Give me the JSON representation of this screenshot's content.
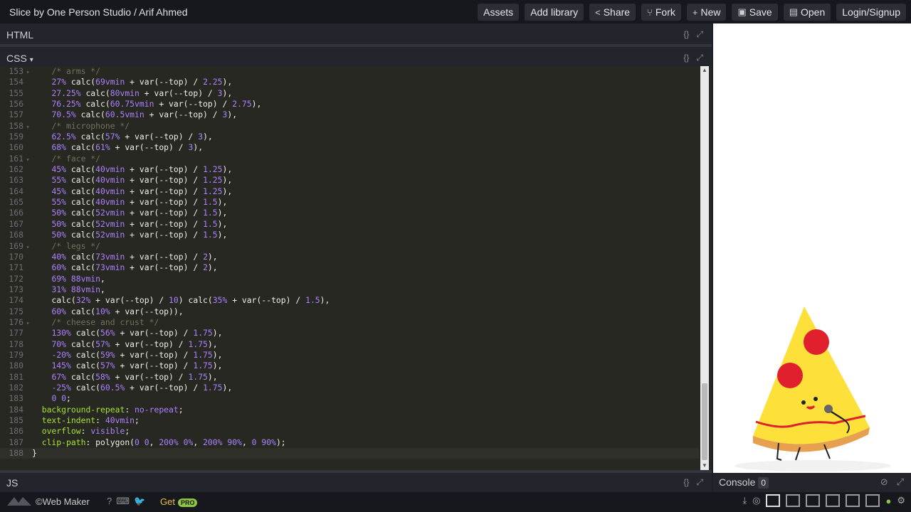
{
  "topbar": {
    "title": "Slice by One Person Studio / Arif Ahmed",
    "buttons": [
      "Assets",
      "Add library",
      "Share",
      "Fork",
      "New",
      "Save",
      "Open",
      "Login/Signup"
    ]
  },
  "panes": {
    "html": "HTML",
    "css": "CSS",
    "js": "JS",
    "console": "Console",
    "console_count": "0",
    "ctrl_format": "{}",
    "ctrl_expand": "⤢"
  },
  "code_lines": [
    {
      "n": "153",
      "fold": true,
      "html": "    <span class='cmt'>/* arms */</span>"
    },
    {
      "n": "154",
      "fold": false,
      "html": "    <span class='num'>27%</span> calc(<span class='num'>69vmin</span> + var(<span class='code'>--top</span>) / <span class='num'>2.25</span>),"
    },
    {
      "n": "155",
      "fold": false,
      "html": "    <span class='num'>27.25%</span> calc(<span class='num'>80vmin</span> + var(--top) / <span class='num'>3</span>),"
    },
    {
      "n": "156",
      "fold": false,
      "html": "    <span class='num'>76.25%</span> calc(<span class='num'>60.75vmin</span> + var(--top) / <span class='num'>2.75</span>),"
    },
    {
      "n": "157",
      "fold": false,
      "html": "    <span class='num'>70.5%</span> calc(<span class='num'>60.5vmin</span> + var(--top) / <span class='num'>3</span>),"
    },
    {
      "n": "158",
      "fold": true,
      "html": "    <span class='cmt'>/* microphone */</span>"
    },
    {
      "n": "159",
      "fold": false,
      "html": "    <span class='num'>62.5%</span> calc(<span class='num'>57%</span> + var(--top) / <span class='num'>3</span>),"
    },
    {
      "n": "160",
      "fold": false,
      "html": "    <span class='num'>68%</span> calc(<span class='num'>61%</span> + var(--top) / <span class='num'>3</span>),"
    },
    {
      "n": "161",
      "fold": true,
      "html": "    <span class='cmt'>/* face */</span>"
    },
    {
      "n": "162",
      "fold": false,
      "html": "    <span class='num'>45%</span> calc(<span class='num'>40vmin</span> + var(--top) / <span class='num'>1.25</span>),"
    },
    {
      "n": "163",
      "fold": false,
      "html": "    <span class='num'>55%</span> calc(<span class='num'>40vmin</span> + var(--top) / <span class='num'>1.25</span>),"
    },
    {
      "n": "164",
      "fold": false,
      "html": "    <span class='num'>45%</span> calc(<span class='num'>40vmin</span> + var(--top) / <span class='num'>1.25</span>),"
    },
    {
      "n": "165",
      "fold": false,
      "html": "    <span class='num'>55%</span> calc(<span class='num'>40vmin</span> + var(--top) / <span class='num'>1.5</span>),"
    },
    {
      "n": "166",
      "fold": false,
      "html": "    <span class='num'>50%</span> calc(<span class='num'>52vmin</span> + var(--top) / <span class='num'>1.5</span>),"
    },
    {
      "n": "167",
      "fold": false,
      "html": "    <span class='num'>50%</span> calc(<span class='num'>52vmin</span> + var(--top) / <span class='num'>1.5</span>),"
    },
    {
      "n": "168",
      "fold": false,
      "html": "    <span class='num'>50%</span> calc(<span class='num'>52vmin</span> + var(--top) / <span class='num'>1.5</span>),"
    },
    {
      "n": "169",
      "fold": true,
      "html": "    <span class='cmt'>/* legs */</span>"
    },
    {
      "n": "170",
      "fold": false,
      "html": "    <span class='num'>40%</span> calc(<span class='num'>73vmin</span> + var(--top) / <span class='num'>2</span>),"
    },
    {
      "n": "171",
      "fold": false,
      "html": "    <span class='num'>60%</span> calc(<span class='num'>73vmin</span> + var(--top) / <span class='num'>2</span>),"
    },
    {
      "n": "172",
      "fold": false,
      "html": "    <span class='num'>69%</span> <span class='num'>88vmin</span>,"
    },
    {
      "n": "173",
      "fold": false,
      "html": "    <span class='num'>31%</span> <span class='num'>88vmin</span>,"
    },
    {
      "n": "174",
      "fold": false,
      "html": "    calc(<span class='num'>32%</span> + var(--top) / <span class='num'>10</span>) calc(<span class='num'>35%</span> + var(--top) / <span class='num'>1.5</span>),"
    },
    {
      "n": "175",
      "fold": false,
      "html": "    <span class='num'>60%</span> calc(<span class='num'>10%</span> + var(--top)),"
    },
    {
      "n": "176",
      "fold": true,
      "html": "    <span class='cmt'>/* cheese and crust */</span>"
    },
    {
      "n": "177",
      "fold": false,
      "html": "    <span class='num'>130%</span> calc(<span class='num'>56%</span> + var(--top) / <span class='num'>1.75</span>),"
    },
    {
      "n": "178",
      "fold": false,
      "html": "    <span class='num'>70%</span> calc(<span class='num'>57%</span> + var(--top) / <span class='num'>1.75</span>),"
    },
    {
      "n": "179",
      "fold": false,
      "html": "    <span class='num'>-20%</span> calc(<span class='num'>59%</span> + var(--top) / <span class='num'>1.75</span>),"
    },
    {
      "n": "180",
      "fold": false,
      "html": "    <span class='num'>145%</span> calc(<span class='num'>57%</span> + var(--top) / <span class='num'>1.75</span>),"
    },
    {
      "n": "181",
      "fold": false,
      "html": "    <span class='num'>67%</span> calc(<span class='num'>58%</span> + var(--top) / <span class='num'>1.75</span>),"
    },
    {
      "n": "182",
      "fold": false,
      "html": "    <span class='num'>-25%</span> calc(<span class='num'>60.5%</span> + var(--top) / <span class='num'>1.75</span>),"
    },
    {
      "n": "183",
      "fold": false,
      "html": "    <span class='num'>0 0</span>;"
    },
    {
      "n": "184",
      "fold": false,
      "html": "  <span class='prop'>background-repeat</span>: <span class='str'>no-repeat</span>;"
    },
    {
      "n": "185",
      "fold": false,
      "html": "  <span class='prop'>text-indent</span>: <span class='num'>40vmin</span>;"
    },
    {
      "n": "186",
      "fold": false,
      "html": "  <span class='prop'>overflow</span>: <span class='str'>visible</span>;"
    },
    {
      "n": "187",
      "fold": false,
      "html": "  <span class='prop'>clip-path</span>: polygon(<span class='num'>0 0</span>, <span class='num'>200% 0%</span>, <span class='num'>200% 90%</span>, <span class='num'>0 90%</span>);"
    },
    {
      "n": "188",
      "fold": false,
      "html": "}"
    }
  ],
  "footer": {
    "brand": "©Web Maker",
    "get": "Get",
    "pro": "PRO"
  },
  "colors": {
    "editor_bg": "#272822",
    "pizza_cheese": "#fde03a",
    "pizza_pepperoni": "#e0202c",
    "pizza_crust": "#e7a04f"
  }
}
